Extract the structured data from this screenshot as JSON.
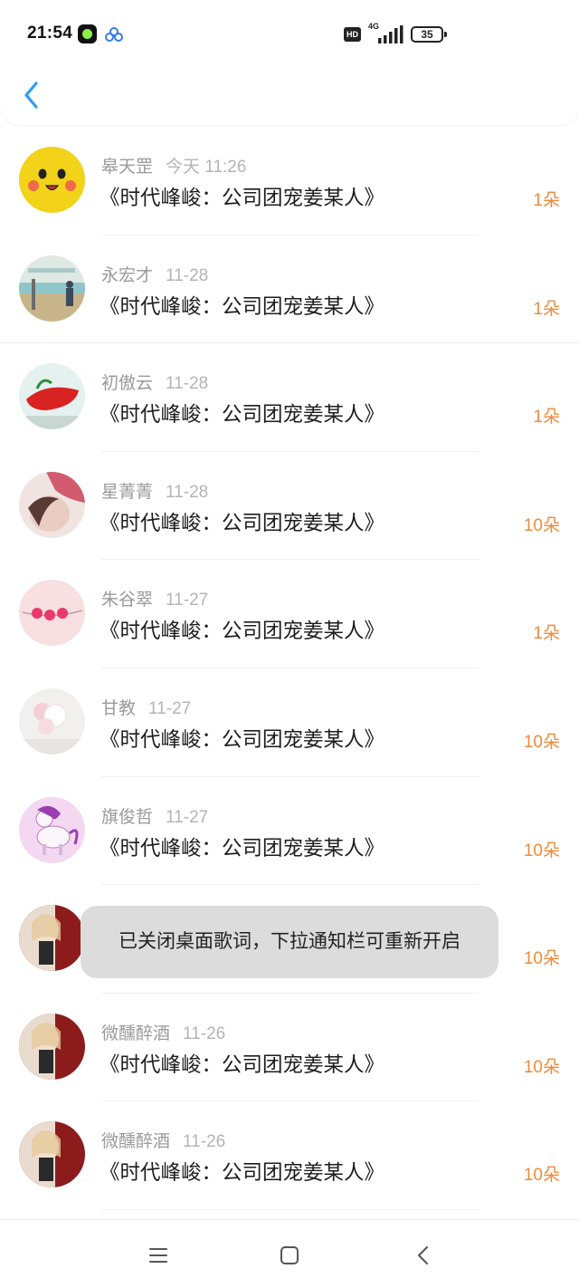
{
  "status_bar": {
    "time": "21:54",
    "hd_label": "HD",
    "network": "4G",
    "battery": "35"
  },
  "header": {
    "back_icon": "chevron-left-icon"
  },
  "gifts": [
    {
      "name": "皋天罡",
      "date": "今天 11:26",
      "title": "《时代峰峻：公司团宠姜某人》",
      "count": "1朵"
    },
    {
      "name": "永宏才",
      "date": "11-28",
      "title": "《时代峰峻：公司团宠姜某人》",
      "count": "1朵"
    },
    {
      "name": "初傲云",
      "date": "11-28",
      "title": "《时代峰峻：公司团宠姜某人》",
      "count": "1朵"
    },
    {
      "name": "星菁菁",
      "date": "11-28",
      "title": "《时代峰峻：公司团宠姜某人》",
      "count": "10朵"
    },
    {
      "name": "朱谷翠",
      "date": "11-27",
      "title": "《时代峰峻：公司团宠姜某人》",
      "count": "1朵"
    },
    {
      "name": "甘教",
      "date": "11-27",
      "title": "《时代峰峻：公司团宠姜某人》",
      "count": "10朵"
    },
    {
      "name": "旗俊哲",
      "date": "11-27",
      "title": "《时代峰峻：公司团宠姜某人》",
      "count": "10朵"
    },
    {
      "name": "",
      "date": "",
      "title": "",
      "count": "10朵"
    },
    {
      "name": "微醺醉酒",
      "date": "11-26",
      "title": "《时代峰峻：公司团宠姜某人》",
      "count": "10朵"
    },
    {
      "name": "微醺醉酒",
      "date": "11-26",
      "title": "《时代峰峻：公司团宠姜某人》",
      "count": "10朵"
    }
  ],
  "toast": {
    "text": "已关闭桌面歌词，下拉通知栏可重新开启"
  },
  "nav_bar": {
    "menu_icon": "menu-icon",
    "home_icon": "home-square-icon",
    "back_icon": "back-chevron-icon"
  },
  "colors": {
    "accent_blue": "#2f9ef3",
    "count_orange": "#f08a3a"
  }
}
